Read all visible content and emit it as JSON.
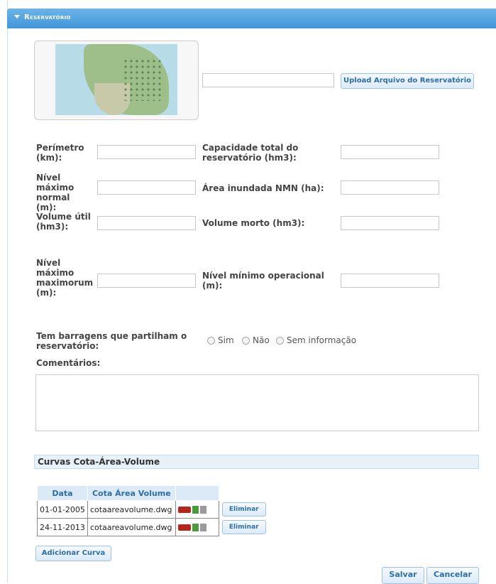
{
  "header": {
    "title": "Reservatório"
  },
  "upload": {
    "file_value": "",
    "button_label": "Upload Arquivo do Reservatório"
  },
  "fields": {
    "perimetro": {
      "label": "Perímetro (km):",
      "value": ""
    },
    "capacidade": {
      "label": "Capacidade total do reservatório (hm3):",
      "value": ""
    },
    "nivel_maximo_normal": {
      "label": "Nível máximo normal (m):",
      "value": ""
    },
    "area_inundada": {
      "label": "Área inundada NMN (ha):",
      "value": ""
    },
    "volume_util": {
      "label": "Volume útil (hm3):",
      "value": ""
    },
    "volume_morto": {
      "label": "Volume morto (hm3):",
      "value": ""
    },
    "nivel_maximo_maximorum": {
      "label": "Nível máximo maximorum (m):",
      "value": ""
    },
    "nivel_minimo_operacional": {
      "label": "Nível mínimo operacional (m):",
      "value": ""
    }
  },
  "barragens": {
    "label": "Tem barragens que partilham o reservatório:",
    "options": [
      "Sim",
      "Não",
      "Sem informação"
    ]
  },
  "comentarios": {
    "label": "Comentários:",
    "value": ""
  },
  "curvas": {
    "section_title": "Curvas Cota-Área-Volume",
    "columns": [
      "Data",
      "Cota Área Volume",
      ""
    ],
    "rows": [
      {
        "data": "01-01-2005",
        "file": "cotaareavolume.dwg",
        "action": "Eliminar"
      },
      {
        "data": "24-11-2013",
        "file": "cotaareavolume.dwg",
        "action": "Eliminar"
      }
    ],
    "add_label": "Adicionar Curva"
  },
  "actions": {
    "save_label": "Salvar",
    "cancel_label": "Cancelar"
  },
  "colors": {
    "header": "#4fa3e2",
    "button_text": "#2e6ea6"
  }
}
